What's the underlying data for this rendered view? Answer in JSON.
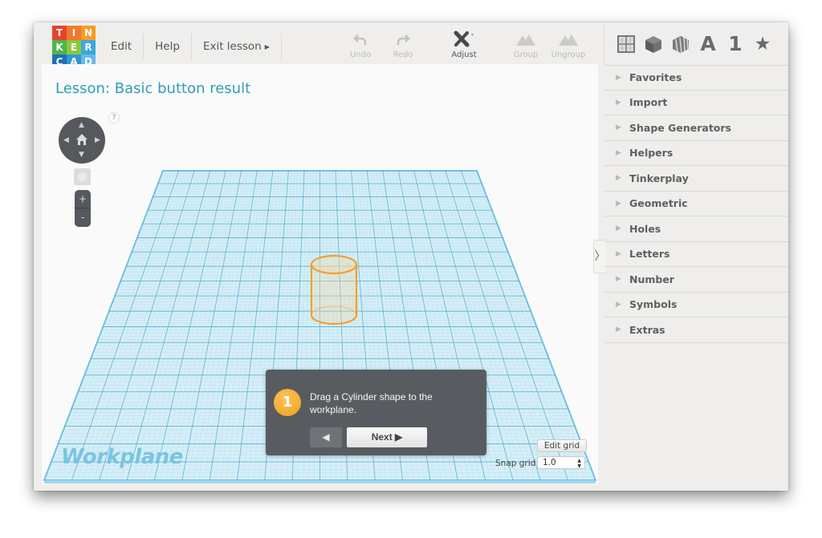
{
  "logo": {
    "letters": [
      "T",
      "I",
      "N",
      "K",
      "E",
      "R",
      "C",
      "A",
      "D"
    ],
    "colors": [
      "#e8412c",
      "#f4782a",
      "#f79c27",
      "#4db748",
      "#8ec53f",
      "#3aa8df",
      "#1f6fb6",
      "#2f97d6",
      "#67b9e6"
    ]
  },
  "menu": {
    "items": [
      {
        "label": "Edit"
      },
      {
        "label": "Help"
      },
      {
        "label": "Exit lesson",
        "icon": "triangle-right-icon"
      }
    ]
  },
  "toolbar": {
    "undo": {
      "label": "Undo",
      "enabled": false,
      "icon": "undo-icon"
    },
    "redo": {
      "label": "Redo",
      "enabled": false,
      "icon": "redo-icon"
    },
    "adjust": {
      "label": "Adjust",
      "enabled": true,
      "icon": "adjust-tools-icon"
    },
    "group": {
      "label": "Group",
      "enabled": false,
      "icon": "group-icon"
    },
    "ungroup": {
      "label": "Ungroup",
      "enabled": false,
      "icon": "ungroup-icon"
    }
  },
  "shapebar": {
    "icons": [
      "workplane-grid-icon",
      "solid-box-icon",
      "striped-box-icon",
      "letters-icon",
      "numbers-icon",
      "favorites-star-icon"
    ],
    "letter_label": "A",
    "number_label": "1",
    "star_label": "★"
  },
  "canvas": {
    "lesson_title": "Lesson: Basic button result",
    "help_label": "?",
    "zoom_in_label": "+",
    "zoom_out_label": "-",
    "workplane_label": "Workplane",
    "grid_color": "#7ccbe6",
    "shape_color": "#f0a030"
  },
  "lesson_popup": {
    "step_number": "1",
    "text": "Drag a Cylinder shape to the workplane.",
    "prev_label": "◀",
    "next_label": "Next ▶"
  },
  "grid_controls": {
    "edit_grid_label": "Edit grid",
    "snap_grid_label": "Snap grid",
    "snap_grid_value": "1.0"
  },
  "sidebar": {
    "collapse_label": "〉",
    "categories": [
      {
        "label": "Favorites"
      },
      {
        "label": "Import"
      },
      {
        "label": "Shape Generators"
      },
      {
        "label": "Helpers"
      },
      {
        "label": "Tinkerplay"
      },
      {
        "label": "Geometric"
      },
      {
        "label": "Holes"
      },
      {
        "label": "Letters"
      },
      {
        "label": "Number"
      },
      {
        "label": "Symbols"
      },
      {
        "label": "Extras"
      }
    ]
  }
}
